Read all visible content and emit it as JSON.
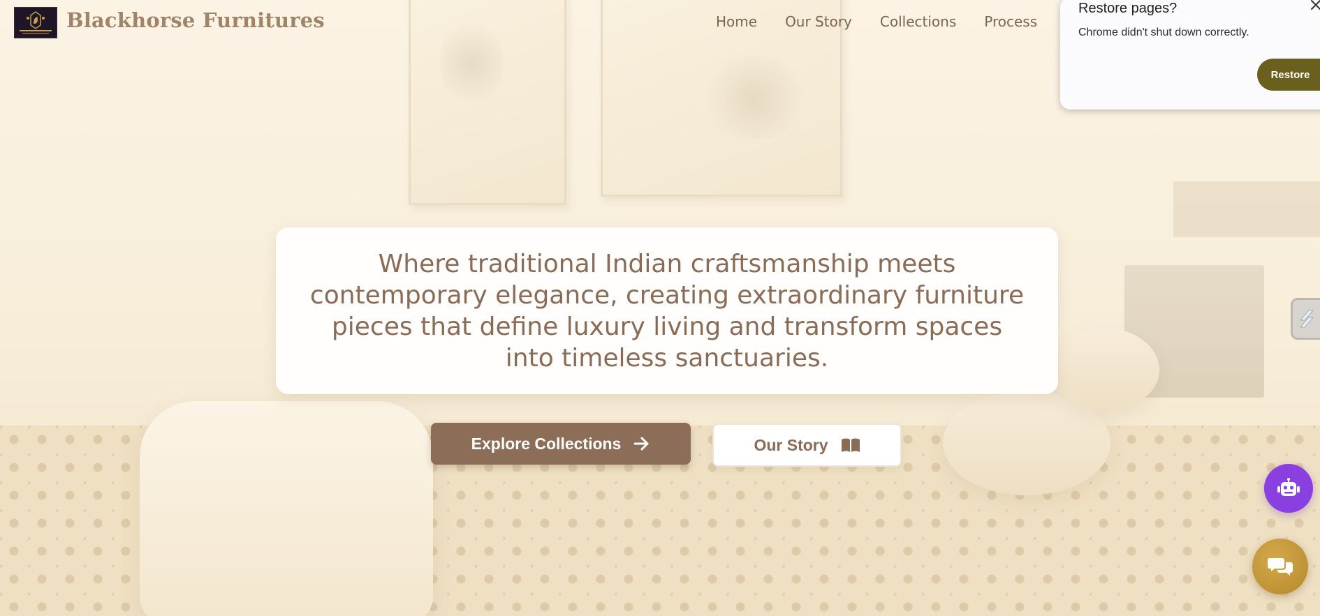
{
  "brand": {
    "name": "Blackhorse Furnitures",
    "color": "#a0846a"
  },
  "nav": {
    "items": [
      {
        "label": "Home"
      },
      {
        "label": "Our Story"
      },
      {
        "label": "Collections"
      },
      {
        "label": "Process"
      }
    ]
  },
  "hero": {
    "text": "Where traditional Indian craftsmanship meets contemporary elegance, creating extraordinary furniture pieces that define luxury living and transform spaces into timeless sanctuaries.",
    "primary_button": {
      "label": "Explore Collections",
      "icon": "arrow-right-icon"
    },
    "secondary_button": {
      "label": "Our Story",
      "icon": "book-open-icon"
    }
  },
  "restore_popup": {
    "title": "Restore pages?",
    "message": "Chrome didn't shut down correctly.",
    "button_label": "Restore",
    "button_color": "#6b5f1e"
  },
  "floating": {
    "bot_button": {
      "icon": "robot-icon",
      "color": "#8a3fe0"
    },
    "chat_button": {
      "icon": "chat-bubbles-icon",
      "color": "#c09236"
    },
    "side_tab": {
      "icon": "extension-tab-icon"
    }
  },
  "colors": {
    "accent": "#8b6d58",
    "text": "#8a6c56",
    "background": "#f6ecd7"
  }
}
